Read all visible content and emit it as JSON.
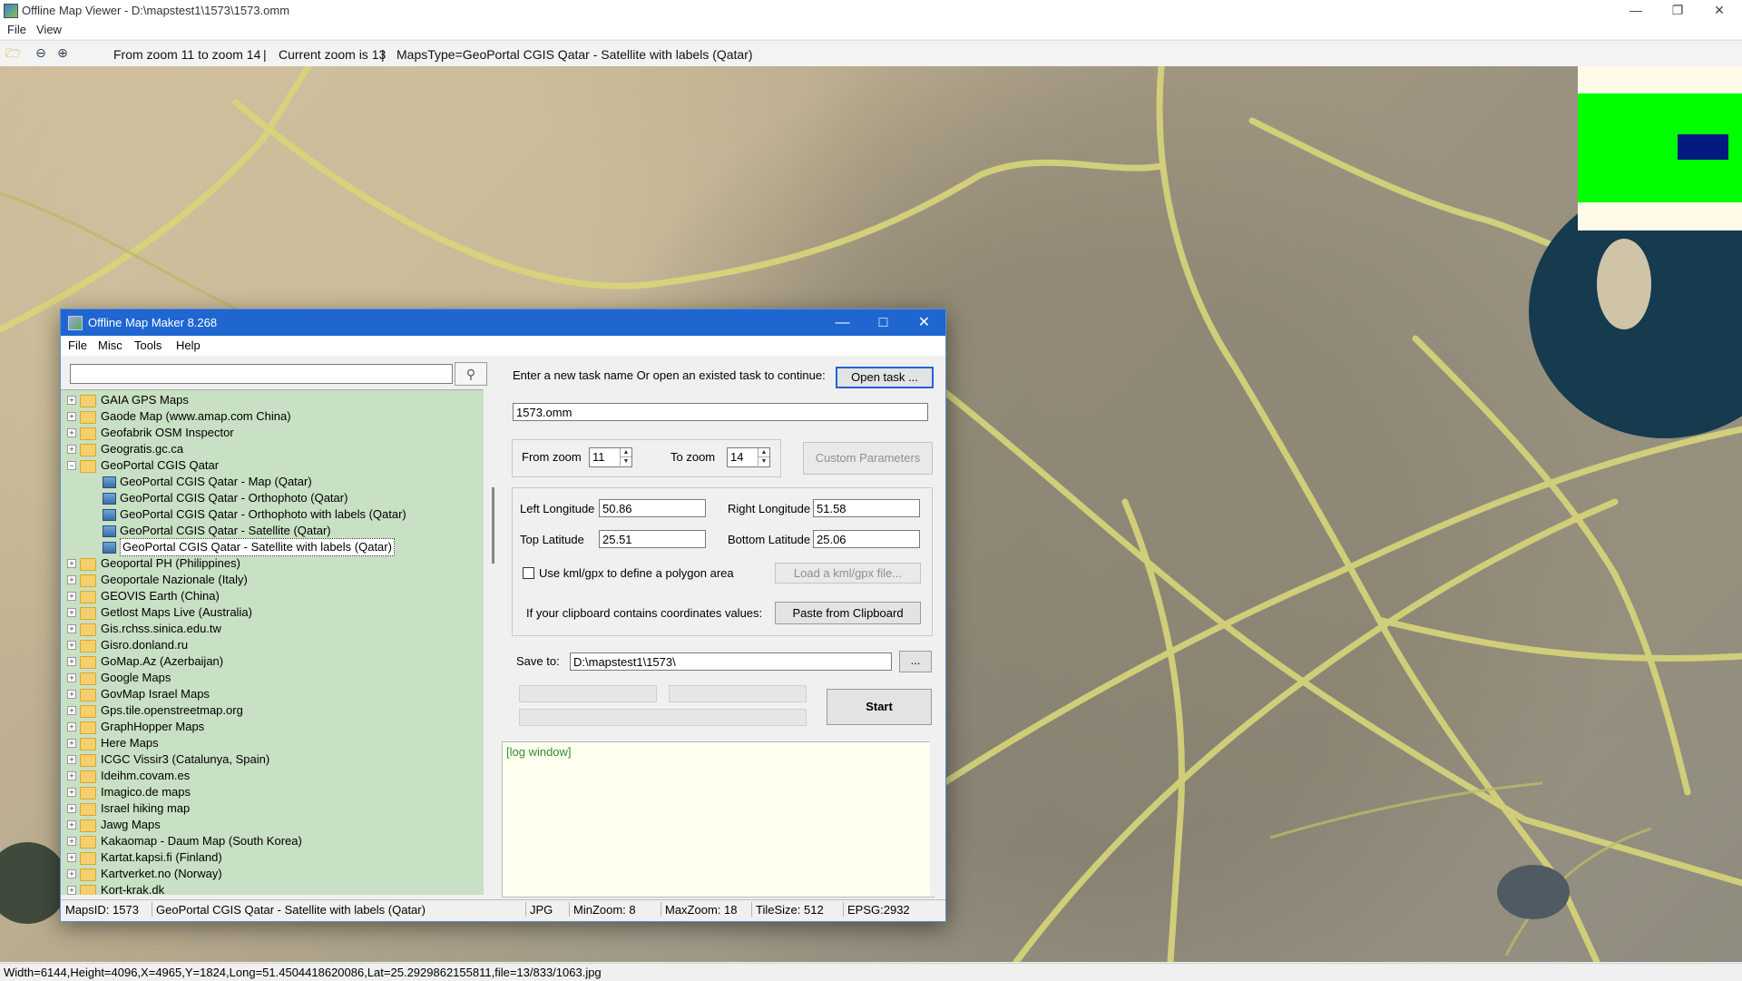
{
  "window": {
    "title": "Offline Map Viewer - D:\\mapstest1\\1573\\1573.omm",
    "menu": [
      "File",
      "View"
    ],
    "toolbar": {
      "zoom_range": "From zoom 11 to zoom 14",
      "sep1": "|",
      "current_zoom": "Current zoom is 13",
      "sep2": "|",
      "maps_type": "MapsType=GeoPortal CGIS Qatar - Satellite with labels (Qatar)"
    },
    "status": "Width=6144,Height=4096,X=4965,Y=1824,Long=51.4504418620086,Lat=25.2929862155811,file=13/833/1063.jpg"
  },
  "dialog": {
    "title": "Offline Map Maker 8.268",
    "menu": [
      "File",
      "Misc",
      "Tools",
      "Help"
    ],
    "tree_items": [
      {
        "label": "GAIA GPS Maps",
        "type": "folder"
      },
      {
        "label": "Gaode Map (www.amap.com China)",
        "type": "folder"
      },
      {
        "label": "Geofabrik OSM Inspector",
        "type": "folder"
      },
      {
        "label": "Geogratis.gc.ca",
        "type": "folder"
      },
      {
        "label": "GeoPortal CGIS Qatar",
        "type": "folder-open"
      },
      {
        "label": "GeoPortal CGIS Qatar - Map (Qatar)",
        "type": "map"
      },
      {
        "label": "GeoPortal CGIS Qatar - Orthophoto (Qatar)",
        "type": "map"
      },
      {
        "label": "GeoPortal CGIS Qatar - Orthophoto with labels (Qatar)",
        "type": "map"
      },
      {
        "label": "GeoPortal CGIS Qatar - Satellite (Qatar)",
        "type": "map"
      },
      {
        "label": "GeoPortal CGIS Qatar - Satellite with labels (Qatar)",
        "type": "map-selected"
      },
      {
        "label": "Geoportal PH (Philippines)",
        "type": "folder"
      },
      {
        "label": "Geoportale Nazionale (Italy)",
        "type": "folder"
      },
      {
        "label": "GEOVIS Earth (China)",
        "type": "folder"
      },
      {
        "label": "Getlost Maps Live (Australia)",
        "type": "folder"
      },
      {
        "label": "Gis.rchss.sinica.edu.tw",
        "type": "folder"
      },
      {
        "label": "Gisro.donland.ru",
        "type": "folder"
      },
      {
        "label": "GoMap.Az (Azerbaijan)",
        "type": "folder"
      },
      {
        "label": "Google Maps",
        "type": "folder"
      },
      {
        "label": "GovMap Israel Maps",
        "type": "folder"
      },
      {
        "label": "Gps.tile.openstreetmap.org",
        "type": "folder"
      },
      {
        "label": "GraphHopper Maps",
        "type": "folder"
      },
      {
        "label": "Here Maps",
        "type": "folder"
      },
      {
        "label": "ICGC Vissir3 (Catalunya, Spain)",
        "type": "folder"
      },
      {
        "label": "Ideihm.covam.es",
        "type": "folder"
      },
      {
        "label": "Imagico.de maps",
        "type": "folder"
      },
      {
        "label": "Israel hiking map",
        "type": "folder"
      },
      {
        "label": "Jawg Maps",
        "type": "folder"
      },
      {
        "label": "Kakaomap - Daum Map (South Korea)",
        "type": "folder"
      },
      {
        "label": "Kartat.kapsi.fi (Finland)",
        "type": "folder"
      },
      {
        "label": "Kartverket.no (Norway)",
        "type": "folder"
      },
      {
        "label": "Kort-krak.dk",
        "type": "folder"
      }
    ],
    "task_prompt": "Enter a new task name Or open an existed task to continue:",
    "open_task_btn": "Open task ...",
    "task_name": "1573.omm",
    "from_zoom_label": "From zoom",
    "from_zoom": "11",
    "to_zoom_label": "To zoom",
    "to_zoom": "14",
    "custom_params_btn": "Custom Parameters",
    "left_long_label": "Left Longitude",
    "left_long": "50.86",
    "right_long_label": "Right Longitude",
    "right_long": "51.58",
    "top_lat_label": "Top Latitude",
    "top_lat": "25.51",
    "bottom_lat_label": "Bottom Latitude",
    "bottom_lat": "25.06",
    "kml_label": "Use kml/gpx to define a polygon area",
    "load_kml_btn": "Load a kml/gpx file...",
    "clipboard_label": "If your clipboard contains coordinates values:",
    "paste_btn": "Paste from Clipboard",
    "save_to_label": "Save to:",
    "save_to": "D:\\mapstest1\\1573\\",
    "browse_btn": "...",
    "start_btn": "Start",
    "log": "[log window]",
    "status": {
      "maps_id": "MapsID: 1573",
      "name": "GeoPortal CGIS Qatar - Satellite with labels (Qatar)",
      "format": "JPG",
      "min_zoom": "MinZoom: 8",
      "max_zoom": "MaxZoom: 18",
      "tile_size": "TileSize: 512",
      "epsg": "EPSG:2932"
    }
  },
  "colors": {
    "dialog_titlebar": "#1f66d1",
    "tree_bg": "#c8e0c3",
    "overview_green": "#00ff00",
    "overview_view": "#001a80",
    "log_text": "#2f8c2f"
  }
}
